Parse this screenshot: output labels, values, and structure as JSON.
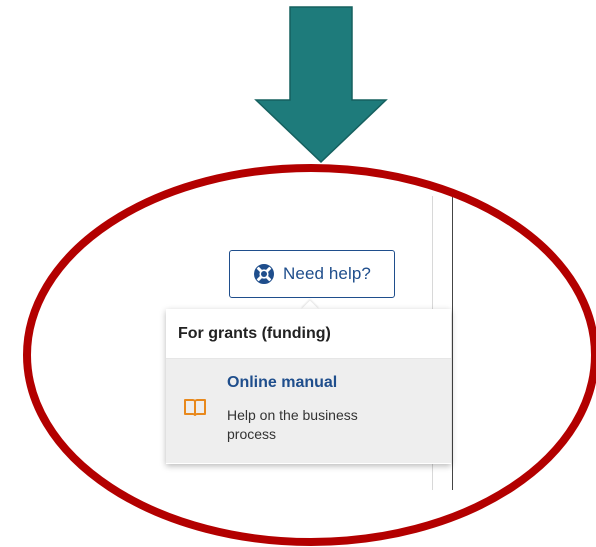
{
  "help_button": {
    "label": "Need help?",
    "icon": "lifebuoy-icon"
  },
  "dropdown": {
    "header": "For grants (funding)",
    "items": [
      {
        "title": "Online manual",
        "description": "Help on the business process",
        "icon": "book-icon"
      }
    ]
  },
  "colors": {
    "arrow": "#1e7b7b",
    "ellipse": "#b30000",
    "link": "#1f4e8c",
    "book_icon": "#e8891d"
  }
}
